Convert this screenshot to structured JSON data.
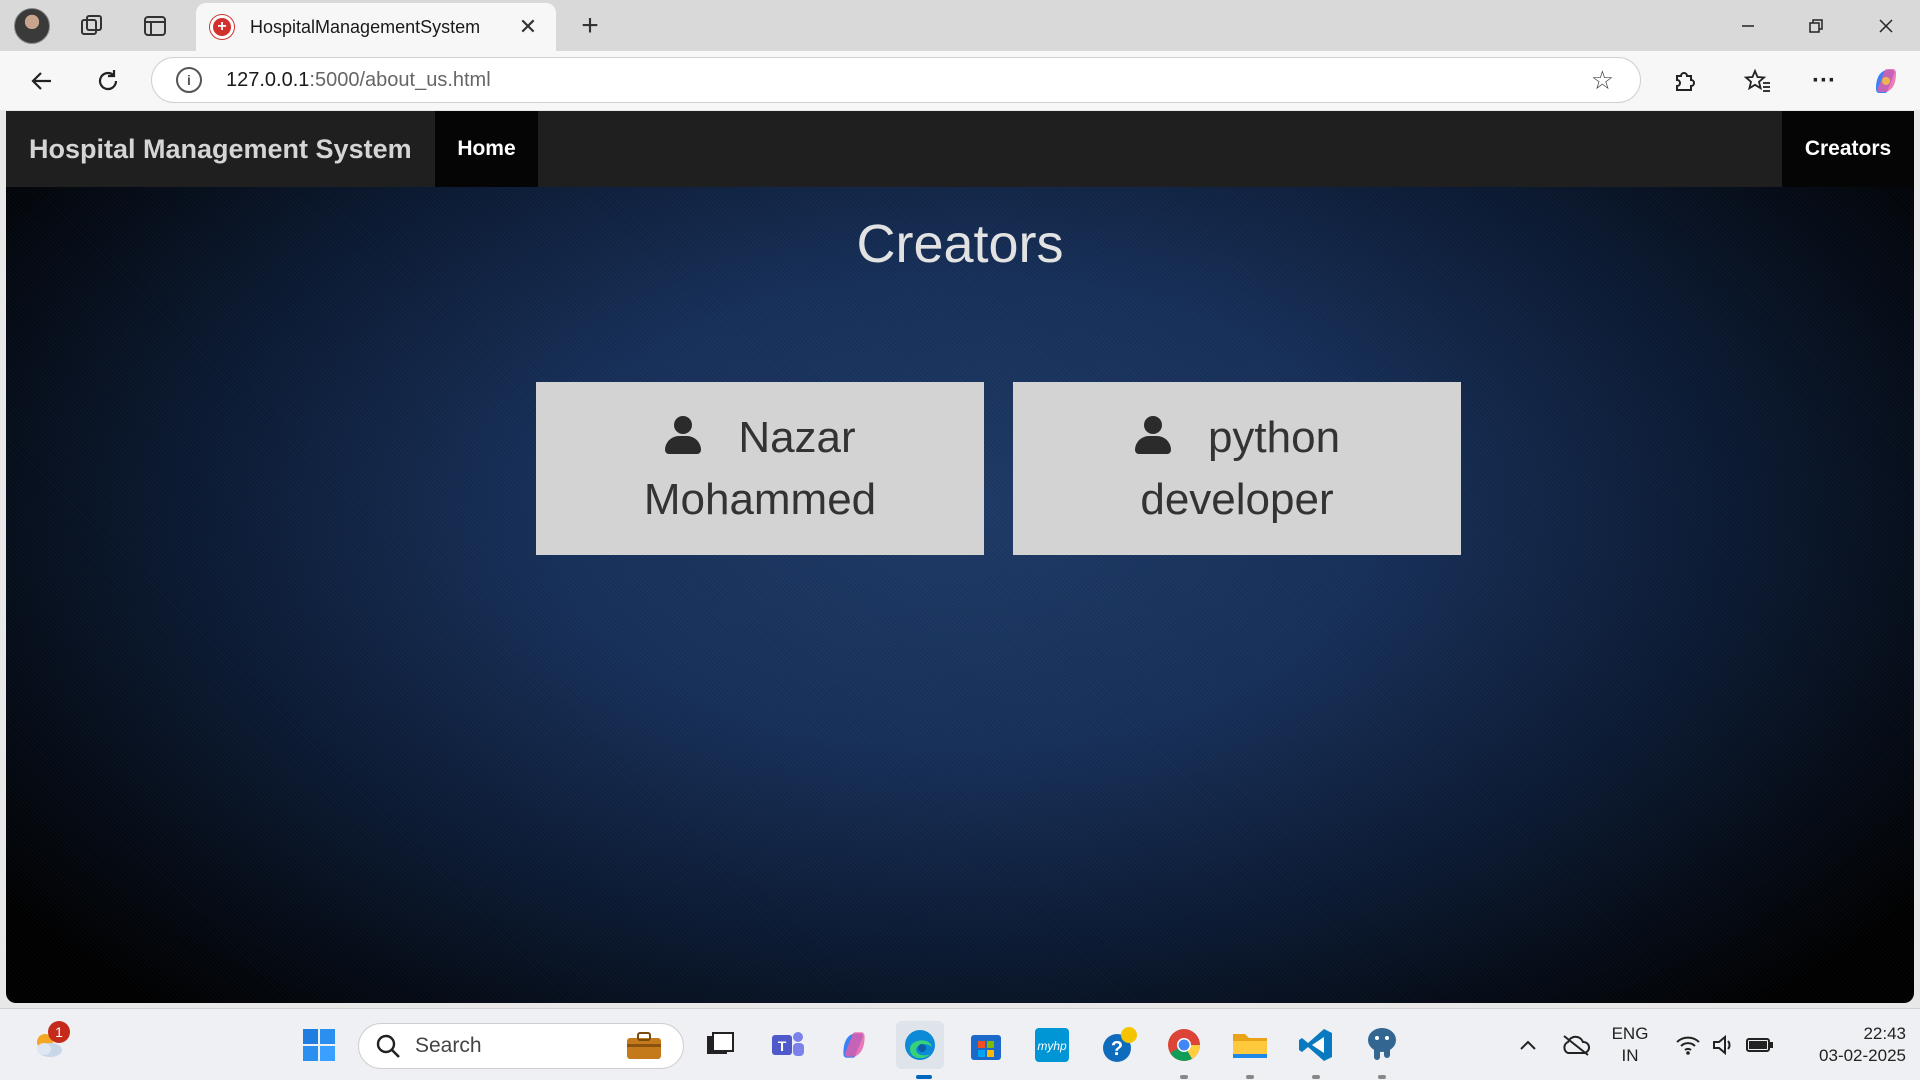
{
  "browser": {
    "tab_title": "HospitalManagementSystem",
    "tab_close": "✕",
    "new_tab": "+",
    "url_host": "127.0.0.1",
    "url_rest": ":5000/about_us.html",
    "info": "i"
  },
  "navbar": {
    "brand": "Hospital Management System",
    "home": "Home",
    "creators": "Creators"
  },
  "main": {
    "heading": "Creators",
    "cards": [
      {
        "line1": "Nazar",
        "line2": "Mohammed"
      },
      {
        "line1": "python",
        "line2": "developer"
      }
    ]
  },
  "taskbar": {
    "search_label": "Search",
    "notification_count": "1",
    "lang_line1": "ENG",
    "lang_line2": "IN",
    "time": "22:43",
    "date": "03-02-2025"
  },
  "colors": {
    "navbar": "#1f1f1f",
    "nav_active": "#050505",
    "card": "#d3d3d3",
    "page_bg": "#17305a"
  }
}
